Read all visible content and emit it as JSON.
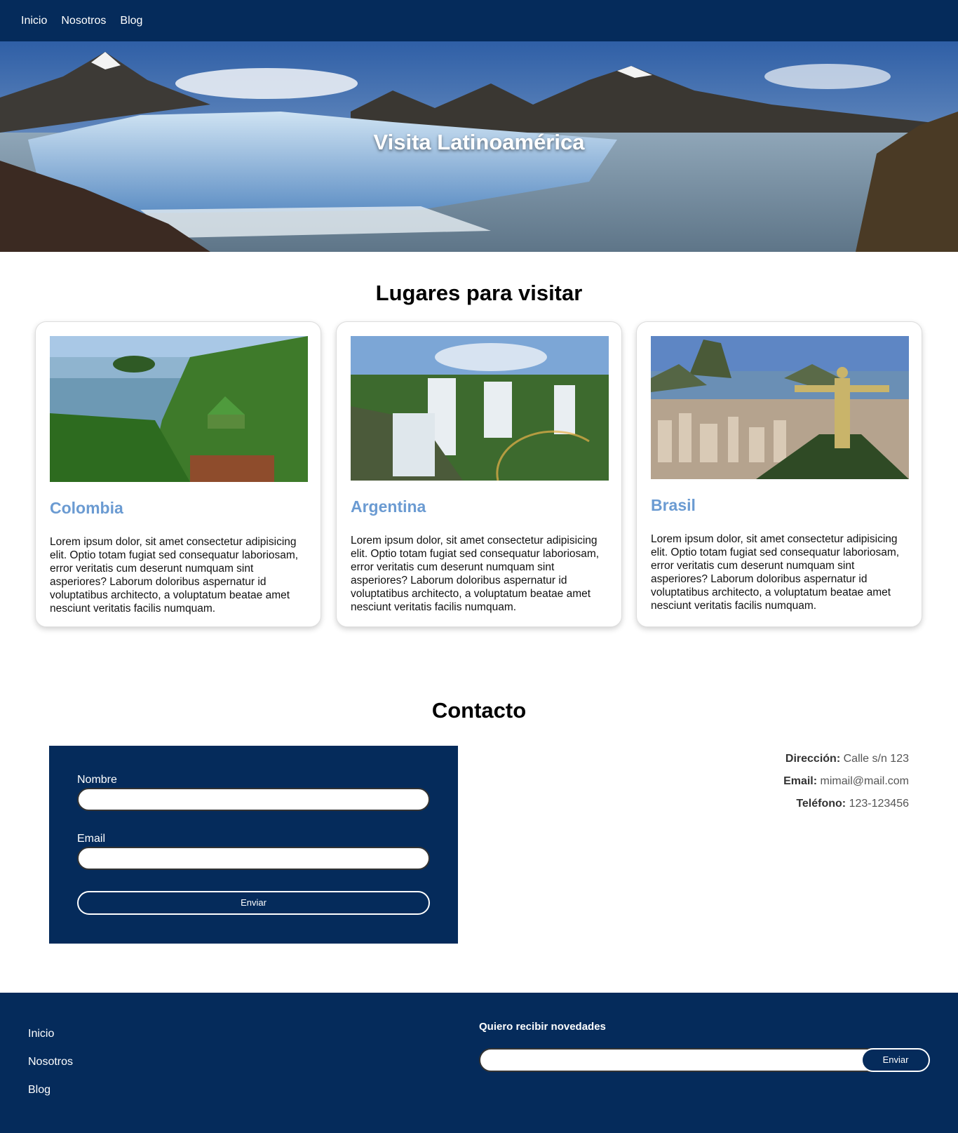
{
  "nav": {
    "items": [
      "Inicio",
      "Nosotros",
      "Blog"
    ]
  },
  "hero": {
    "title": "Visita Latinoamérica"
  },
  "places": {
    "title": "Lugares para visitar",
    "cards": [
      {
        "name": "Colombia",
        "text": "Lorem ipsum dolor, sit amet consectetur adipisicing elit. Optio totam fugiat sed consequatur laboriosam, error veritatis cum deserunt numquam sint asperiores? Laborum doloribus aspernatur id voluptatibus architecto, a voluptatum beatae amet nesciunt veritatis facilis numquam."
      },
      {
        "name": "Argentina",
        "text": "Lorem ipsum dolor, sit amet consectetur adipisicing elit. Optio totam fugiat sed consequatur laboriosam, error veritatis cum deserunt numquam sint asperiores? Laborum doloribus aspernatur id voluptatibus architecto, a voluptatum beatae amet nesciunt veritatis facilis numquam."
      },
      {
        "name": "Brasil",
        "text": "Lorem ipsum dolor, sit amet consectetur adipisicing elit. Optio totam fugiat sed consequatur laboriosam, error veritatis cum deserunt numquam sint asperiores? Laborum doloribus aspernatur id voluptatibus architecto, a voluptatum beatae amet nesciunt veritatis facilis numquam."
      }
    ]
  },
  "contact": {
    "title": "Contacto",
    "name_label": "Nombre",
    "email_label": "Email",
    "submit_label": "Enviar",
    "address_label": "Dirección:",
    "address_value": "Calle s/n 123",
    "email_info_label": "Email:",
    "email_info_value": "mimail@mail.com",
    "phone_label": "Teléfono:",
    "phone_value": "123-123456"
  },
  "footer": {
    "links": [
      "Inicio",
      "Nosotros",
      "Blog"
    ],
    "newsletter_title": "Quiero recibir novedades",
    "newsletter_button": "Enviar"
  },
  "colors": {
    "navy": "#052b5b",
    "card_title": "#6b9bd2"
  }
}
